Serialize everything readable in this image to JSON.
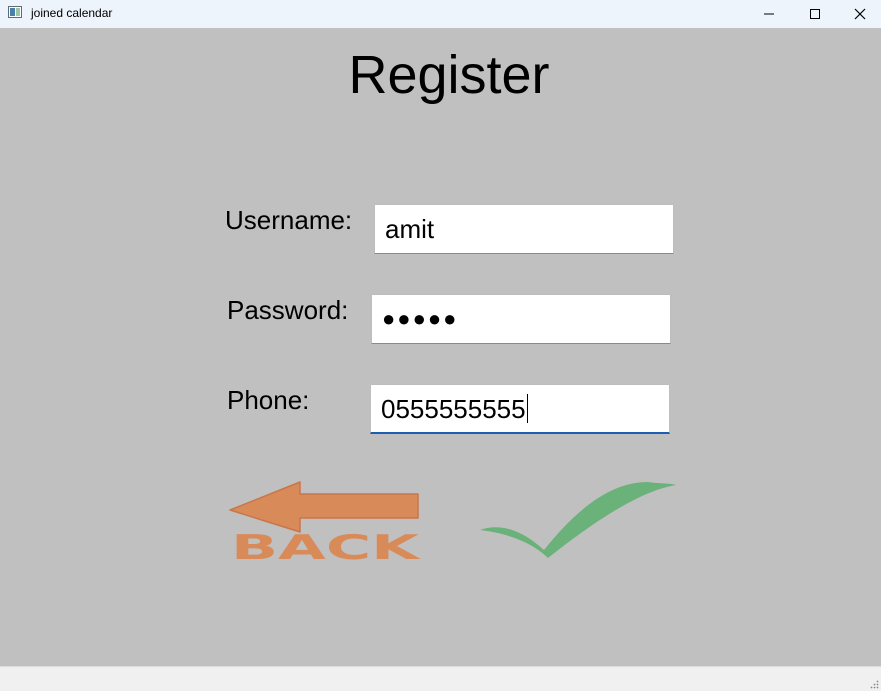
{
  "window": {
    "title": "joined calendar"
  },
  "form": {
    "heading": "Register",
    "username": {
      "label": "Username:",
      "value": "amit"
    },
    "password": {
      "label": "Password:",
      "masked_value": "●●●●●"
    },
    "phone": {
      "label": "Phone:",
      "value": "0555555555"
    }
  },
  "buttons": {
    "back": {
      "text": "BACK",
      "icon": "left-arrow-icon",
      "color": "#d98a59"
    },
    "confirm": {
      "icon": "checkmark-icon",
      "color": "#6bb27a"
    }
  }
}
